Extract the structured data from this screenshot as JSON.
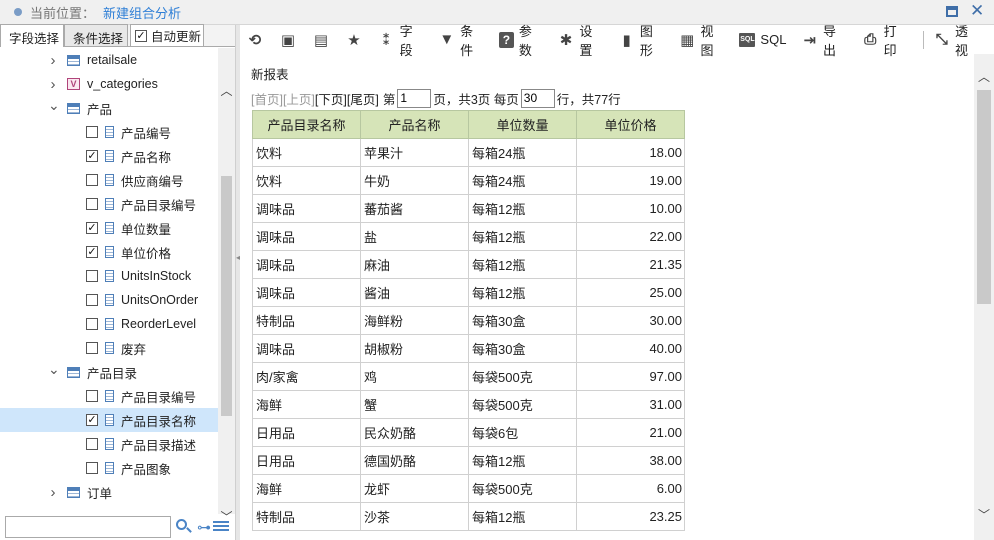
{
  "titlebar": {
    "location_label": "当前位置：",
    "title": "新建组合分析"
  },
  "left_panel": {
    "tabs": [
      {
        "label": "字段选择"
      },
      {
        "label": "条件选择"
      }
    ],
    "auto_update_label": "自动更新",
    "auto_update_checked": true,
    "tree": [
      {
        "type": "table",
        "label": "retailsale",
        "expanded": false
      },
      {
        "type": "view",
        "label": "v_categories",
        "expanded": false
      },
      {
        "type": "table",
        "label": "产品",
        "expanded": true
      },
      {
        "type": "field",
        "label": "产品编号",
        "checked": false
      },
      {
        "type": "field",
        "label": "产品名称",
        "checked": true
      },
      {
        "type": "field",
        "label": "供应商编号",
        "checked": false
      },
      {
        "type": "field",
        "label": "产品目录编号",
        "checked": false
      },
      {
        "type": "field",
        "label": "单位数量",
        "checked": true
      },
      {
        "type": "field",
        "label": "单位价格",
        "checked": true
      },
      {
        "type": "field",
        "label": "UnitsInStock",
        "checked": false
      },
      {
        "type": "field",
        "label": "UnitsOnOrder",
        "checked": false
      },
      {
        "type": "field",
        "label": "ReorderLevel",
        "checked": false
      },
      {
        "type": "field",
        "label": "废弃",
        "checked": false
      },
      {
        "type": "table",
        "label": "产品目录",
        "expanded": true
      },
      {
        "type": "field",
        "label": "产品目录编号",
        "checked": false
      },
      {
        "type": "field",
        "label": "产品目录名称",
        "checked": true,
        "selected": true
      },
      {
        "type": "field",
        "label": "产品目录描述",
        "checked": false
      },
      {
        "type": "field",
        "label": "产品图象",
        "checked": false
      },
      {
        "type": "table",
        "label": "订单",
        "expanded": false
      }
    ],
    "search_placeholder": ""
  },
  "toolbar": {
    "items": [
      {
        "icon": "refresh-icon",
        "label": ""
      },
      {
        "icon": "save-icon",
        "label": ""
      },
      {
        "icon": "save-as-icon",
        "label": ""
      },
      {
        "icon": "star-icon",
        "label": ""
      },
      {
        "icon": "field-icon",
        "label": "字段"
      },
      {
        "icon": "filter-icon",
        "label": "条件"
      },
      {
        "icon": "help-icon",
        "label": "参数"
      },
      {
        "icon": "gear-icon",
        "label": "设置"
      },
      {
        "icon": "bar-chart-icon",
        "label": "图形"
      },
      {
        "icon": "view-icon",
        "label": "视图"
      },
      {
        "icon": "sql-icon",
        "label": "SQL"
      },
      {
        "icon": "export-icon",
        "label": "导出"
      },
      {
        "icon": "print-icon",
        "label": "打印"
      },
      {
        "icon": "pivot-icon",
        "label": "透视"
      }
    ]
  },
  "report": {
    "title": "新报表",
    "pager": {
      "first": "[首页]",
      "prev": "[上页]",
      "next": "[下页]",
      "last": "[尾页]",
      "page_prefix": "第",
      "current_page": "1",
      "page_suffix": "页，共3页 每页",
      "page_size": "30",
      "rows_suffix": "行，共77行"
    },
    "columns": [
      "产品目录名称",
      "产品名称",
      "单位数量",
      "单位价格"
    ],
    "rows": [
      [
        "饮料",
        "苹果汁",
        "每箱24瓶",
        "18.00"
      ],
      [
        "饮料",
        "牛奶",
        "每箱24瓶",
        "19.00"
      ],
      [
        "调味品",
        "蕃茄酱",
        "每箱12瓶",
        "10.00"
      ],
      [
        "调味品",
        "盐",
        "每箱12瓶",
        "22.00"
      ],
      [
        "调味品",
        "麻油",
        "每箱12瓶",
        "21.35"
      ],
      [
        "调味品",
        "酱油",
        "每箱12瓶",
        "25.00"
      ],
      [
        "特制品",
        "海鲜粉",
        "每箱30盒",
        "30.00"
      ],
      [
        "调味品",
        "胡椒粉",
        "每箱30盒",
        "40.00"
      ],
      [
        "肉/家禽",
        "鸡",
        "每袋500克",
        "97.00"
      ],
      [
        "海鲜",
        "蟹",
        "每袋500克",
        "31.00"
      ],
      [
        "日用品",
        "民众奶酪",
        "每袋6包",
        "21.00"
      ],
      [
        "日用品",
        "德国奶酪",
        "每箱12瓶",
        "38.00"
      ],
      [
        "海鲜",
        "龙虾",
        "每袋500克",
        "6.00"
      ],
      [
        "特制品",
        "沙茶",
        "每箱12瓶",
        "23.25"
      ]
    ]
  }
}
